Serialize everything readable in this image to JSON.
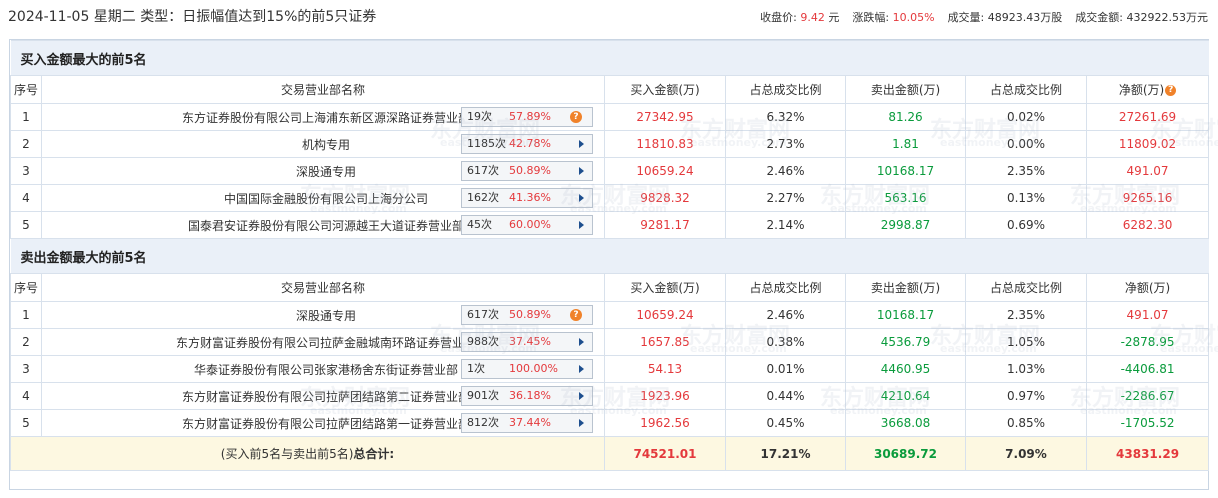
{
  "header": {
    "title": "2024-11-05 星期二 类型：日振幅值达到15%的前5只证券",
    "close_label": "收盘价:",
    "close_value": "9.42",
    "close_unit": "元",
    "change_label": "涨跌幅:",
    "change_value": "10.05%",
    "volume_label": "成交量:",
    "volume_value": "48923.43万股",
    "amount_label": "成交金额:",
    "amount_value": "432922.53万元"
  },
  "columns": {
    "seq": "序号",
    "name": "交易营业部名称",
    "buy": "买入金额(万)",
    "buy_ratio": "占总成交比例",
    "sell": "卖出金额(万)",
    "sell_ratio": "占总成交比例",
    "net": "净额(万)"
  },
  "buy_section": {
    "title": "买入金额最大的前5名",
    "rows": [
      {
        "seq": "1",
        "name": "东方证券股份有限公司上海浦东新区源深路证券营业部",
        "count": "19次",
        "rate": "57.89%",
        "icon": "question-icon",
        "buy": "27342.95",
        "buy_ratio": "6.32%",
        "sell": "81.26",
        "sell_ratio": "0.02%",
        "net": "27261.69"
      },
      {
        "seq": "2",
        "name": "机构专用",
        "count": "1185次",
        "rate": "42.78%",
        "icon": "arrow-right-icon",
        "buy": "11810.83",
        "buy_ratio": "2.73%",
        "sell": "1.81",
        "sell_ratio": "0.00%",
        "net": "11809.02"
      },
      {
        "seq": "3",
        "name": "深股通专用",
        "count": "617次",
        "rate": "50.89%",
        "icon": "arrow-right-icon",
        "buy": "10659.24",
        "buy_ratio": "2.46%",
        "sell": "10168.17",
        "sell_ratio": "2.35%",
        "net": "491.07"
      },
      {
        "seq": "4",
        "name": "中国国际金融股份有限公司上海分公司",
        "count": "162次",
        "rate": "41.36%",
        "icon": "arrow-right-icon",
        "buy": "9828.32",
        "buy_ratio": "2.27%",
        "sell": "563.16",
        "sell_ratio": "0.13%",
        "net": "9265.16"
      },
      {
        "seq": "5",
        "name": "国泰君安证券股份有限公司河源越王大道证券营业部",
        "count": "45次",
        "rate": "60.00%",
        "icon": "arrow-right-icon",
        "buy": "9281.17",
        "buy_ratio": "2.14%",
        "sell": "2998.87",
        "sell_ratio": "0.69%",
        "net": "6282.30"
      }
    ]
  },
  "sell_section": {
    "title": "卖出金额最大的前5名",
    "rows": [
      {
        "seq": "1",
        "name": "深股通专用",
        "count": "617次",
        "rate": "50.89%",
        "icon": "question-icon",
        "buy": "10659.24",
        "buy_ratio": "2.46%",
        "sell": "10168.17",
        "sell_ratio": "2.35%",
        "net": "491.07"
      },
      {
        "seq": "2",
        "name": "东方财富证券股份有限公司拉萨金融城南环路证券营业部",
        "count": "988次",
        "rate": "37.45%",
        "icon": "arrow-right-icon",
        "buy": "1657.85",
        "buy_ratio": "0.38%",
        "sell": "4536.79",
        "sell_ratio": "1.05%",
        "net": "-2878.95"
      },
      {
        "seq": "3",
        "name": "华泰证券股份有限公司张家港杨舍东街证券营业部",
        "count": "1次",
        "rate": "100.00%",
        "icon": "arrow-right-icon",
        "buy": "54.13",
        "buy_ratio": "0.01%",
        "sell": "4460.95",
        "sell_ratio": "1.03%",
        "net": "-4406.81"
      },
      {
        "seq": "4",
        "name": "东方财富证券股份有限公司拉萨团结路第二证券营业部",
        "count": "901次",
        "rate": "36.18%",
        "icon": "arrow-right-icon",
        "buy": "1923.96",
        "buy_ratio": "0.44%",
        "sell": "4210.64",
        "sell_ratio": "0.97%",
        "net": "-2286.67"
      },
      {
        "seq": "5",
        "name": "东方财富证券股份有限公司拉萨团结路第一证券营业部",
        "count": "812次",
        "rate": "37.44%",
        "icon": "arrow-right-icon",
        "buy": "1962.56",
        "buy_ratio": "0.45%",
        "sell": "3668.08",
        "sell_ratio": "0.85%",
        "net": "-1705.52"
      }
    ]
  },
  "summary": {
    "label_prefix": "(买入前5名与卖出前5名)",
    "label_bold": "总合计:",
    "buy": "74521.01",
    "buy_ratio": "17.21%",
    "sell": "30689.72",
    "sell_ratio": "7.09%",
    "net": "43831.29"
  },
  "watermark": {
    "brand": "东方财富网",
    "domain": "eastmoney.com"
  },
  "colors": {
    "red": "#e4393c",
    "green": "#0a9b3c",
    "section_bg": "#eaf0f8",
    "summary_bg": "#fdf8e1",
    "badge_icon": "#f0822a",
    "arrow": "#1e4f8e"
  }
}
